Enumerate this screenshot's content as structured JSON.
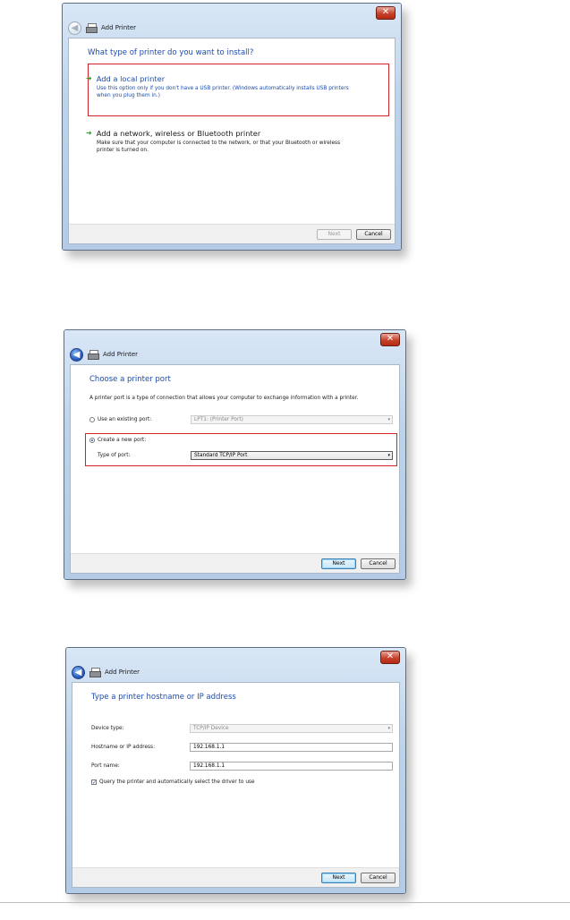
{
  "common": {
    "window_title": "Add Printer",
    "close_glyph": "✕",
    "next_label": "Next",
    "cancel_label": "Cancel"
  },
  "dialog1": {
    "heading": "What type of printer do you want to install?",
    "options": [
      {
        "title": "Add a local printer",
        "desc1": "Use this option only if you don't have a USB printer. (Windows automatically installs USB printers",
        "desc2": "when you plug them in.)"
      },
      {
        "title": "Add a network, wireless or Bluetooth printer",
        "desc1": "Make sure that your computer is connected to the network, or that your Bluetooth or wireless",
        "desc2": "printer is turned on."
      }
    ]
  },
  "dialog2": {
    "heading": "Choose a printer port",
    "description": "A printer port is a type of connection that allows your computer to exchange information with a printer.",
    "existing_port_label": "Use an existing port:",
    "existing_port_value": "LPT1: (Printer Port)",
    "new_port_label": "Create a new port:",
    "type_of_port_label": "Type of port:",
    "type_of_port_value": "Standard TCP/IP Port"
  },
  "dialog3": {
    "heading": "Type a printer hostname or IP address",
    "device_type_label": "Device type:",
    "device_type_value": "TCP/IP Device",
    "hostname_label": "Hostname or IP address:",
    "hostname_value": "192.168.1.1",
    "port_name_label": "Port name:",
    "port_name_value": "192.168.1.1",
    "query_label": "Query the printer and automatically select the driver to use"
  },
  "colors": {
    "link_blue": "#1c4bac",
    "highlight_red": "#d2232a",
    "arrow_green": "#2d9b2d"
  }
}
